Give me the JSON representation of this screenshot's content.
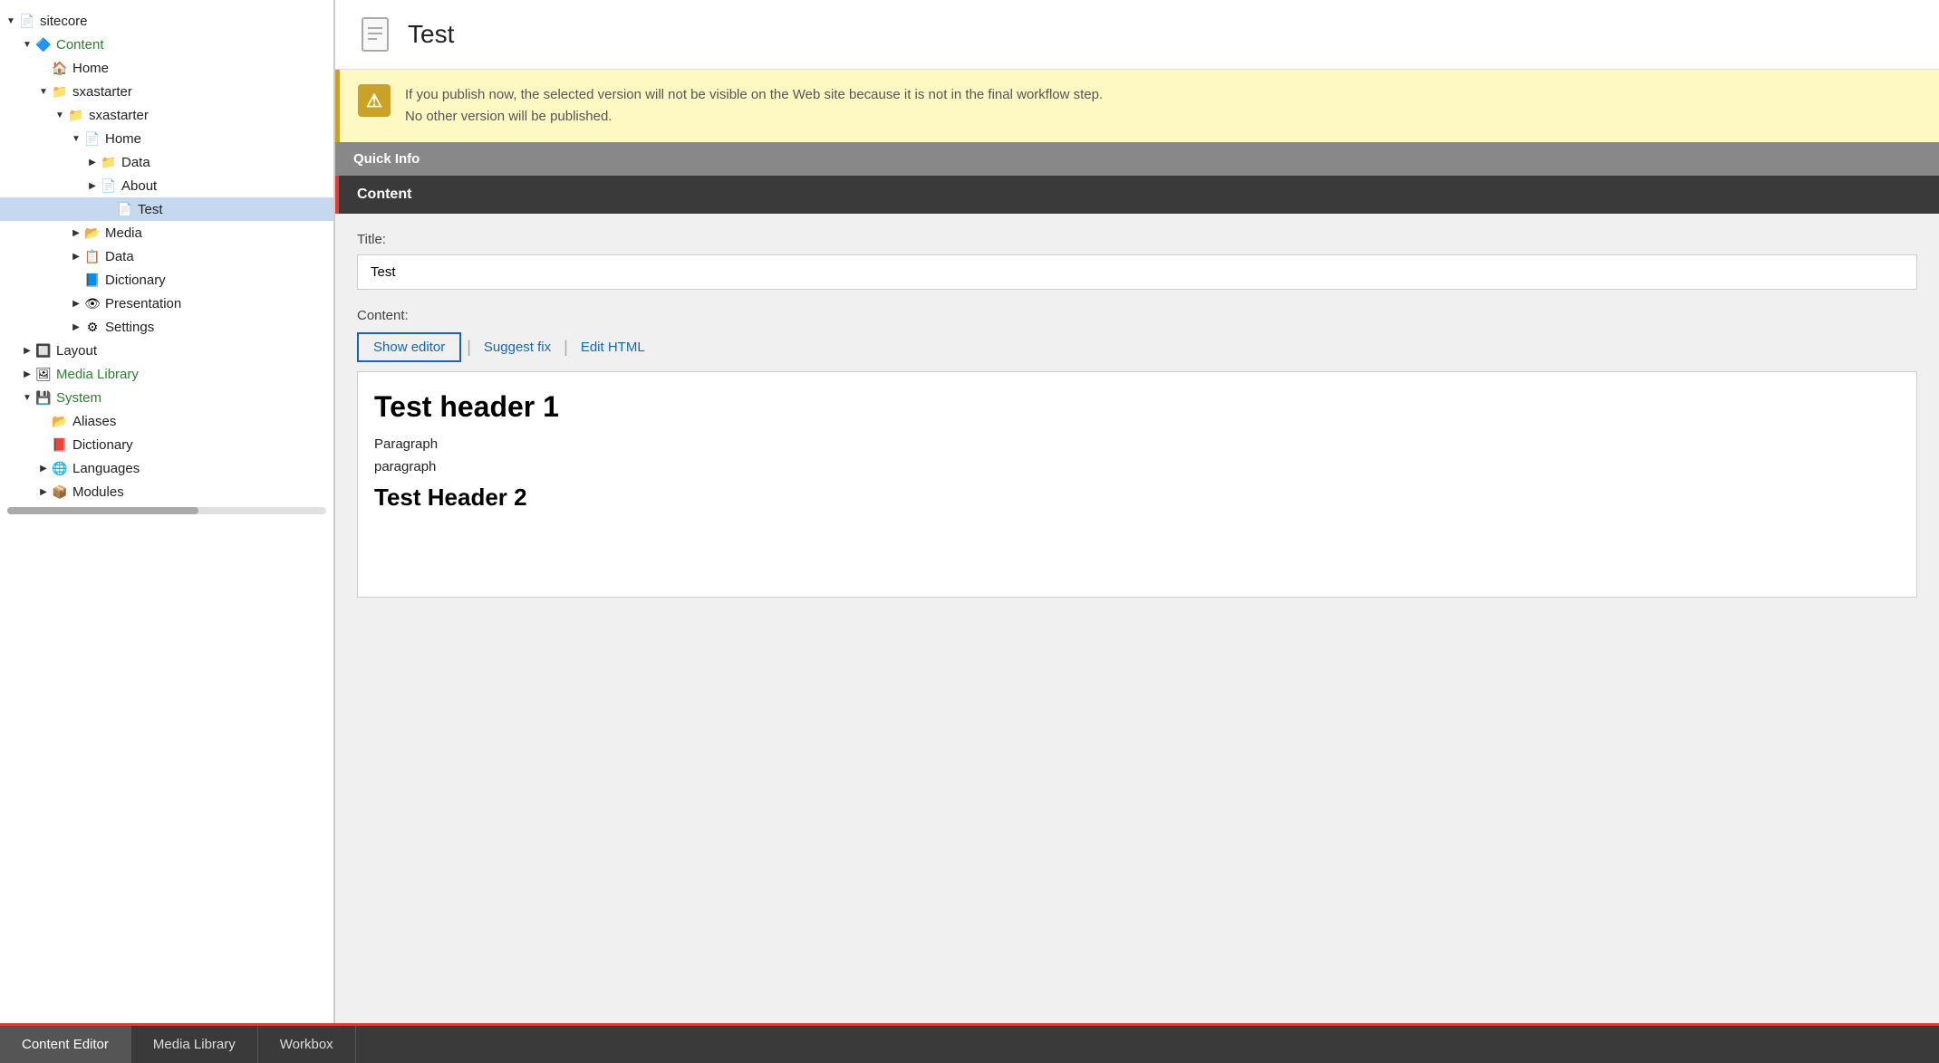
{
  "page": {
    "title": "Test"
  },
  "warning": {
    "line1": "If you publish now, the selected version will not be visible on the Web site because it is not in the final workflow step.",
    "line2": "No other version will be published."
  },
  "sections": {
    "quick_info": "Quick Info",
    "content": "Content"
  },
  "form": {
    "title_label": "Title:",
    "title_value": "Test",
    "content_label": "Content:",
    "show_editor_btn": "Show editor",
    "suggest_fix_btn": "Suggest fix",
    "edit_html_btn": "Edit HTML"
  },
  "editor": {
    "header1": "Test header 1",
    "para1": "Paragraph",
    "para2": "paragraph",
    "header2": "Test Header 2"
  },
  "sidebar": {
    "items": [
      {
        "id": "sitecore",
        "label": "sitecore",
        "indent": 0,
        "arrow": "down",
        "icon": "📄",
        "style": "normal"
      },
      {
        "id": "content",
        "label": "Content",
        "indent": 1,
        "arrow": "down",
        "icon": "🔷",
        "style": "green"
      },
      {
        "id": "home1",
        "label": "Home",
        "indent": 2,
        "arrow": "empty",
        "icon": "🏠",
        "style": "normal"
      },
      {
        "id": "sxastarter1",
        "label": "sxastarter",
        "indent": 2,
        "arrow": "down",
        "icon": "📁",
        "style": "normal"
      },
      {
        "id": "sxastarter2",
        "label": "sxastarter",
        "indent": 3,
        "arrow": "down",
        "icon": "📁",
        "style": "normal"
      },
      {
        "id": "home2",
        "label": "Home",
        "indent": 4,
        "arrow": "down",
        "icon": "📄",
        "style": "normal"
      },
      {
        "id": "data1",
        "label": "Data",
        "indent": 5,
        "arrow": "right",
        "icon": "📁",
        "style": "normal"
      },
      {
        "id": "about",
        "label": "About",
        "indent": 5,
        "arrow": "right",
        "icon": "📄",
        "style": "normal"
      },
      {
        "id": "test",
        "label": "Test",
        "indent": 6,
        "arrow": "empty",
        "icon": "📄",
        "style": "selected"
      },
      {
        "id": "media1",
        "label": "Media",
        "indent": 4,
        "arrow": "right",
        "icon": "📂",
        "style": "normal"
      },
      {
        "id": "data2",
        "label": "Data",
        "indent": 4,
        "arrow": "right",
        "icon": "📋",
        "style": "normal"
      },
      {
        "id": "dictionary1",
        "label": "Dictionary",
        "indent": 4,
        "arrow": "empty",
        "icon": "📘",
        "style": "normal"
      },
      {
        "id": "presentation",
        "label": "Presentation",
        "indent": 4,
        "arrow": "right",
        "icon": "👁",
        "style": "normal"
      },
      {
        "id": "settings",
        "label": "Settings",
        "indent": 4,
        "arrow": "right",
        "icon": "⚙",
        "style": "normal"
      },
      {
        "id": "layout",
        "label": "Layout",
        "indent": 1,
        "arrow": "right",
        "icon": "🔲",
        "style": "normal"
      },
      {
        "id": "media_library",
        "label": "Media Library",
        "indent": 1,
        "arrow": "right",
        "icon": "🖼",
        "style": "green"
      },
      {
        "id": "system",
        "label": "System",
        "indent": 1,
        "arrow": "down",
        "icon": "💾",
        "style": "green"
      },
      {
        "id": "aliases",
        "label": "Aliases",
        "indent": 2,
        "arrow": "empty",
        "icon": "📂",
        "style": "normal"
      },
      {
        "id": "dictionary2",
        "label": "Dictionary",
        "indent": 2,
        "arrow": "empty",
        "icon": "📕",
        "style": "normal"
      },
      {
        "id": "languages",
        "label": "Languages",
        "indent": 2,
        "arrow": "right",
        "icon": "🌐",
        "style": "normal"
      },
      {
        "id": "modules",
        "label": "Modules",
        "indent": 2,
        "arrow": "right",
        "icon": "📦",
        "style": "normal"
      }
    ]
  },
  "bottom_tabs": [
    {
      "id": "content-editor",
      "label": "Content Editor",
      "active": true
    },
    {
      "id": "media-library",
      "label": "Media Library",
      "active": false
    },
    {
      "id": "workbox",
      "label": "Workbox",
      "active": false
    }
  ]
}
